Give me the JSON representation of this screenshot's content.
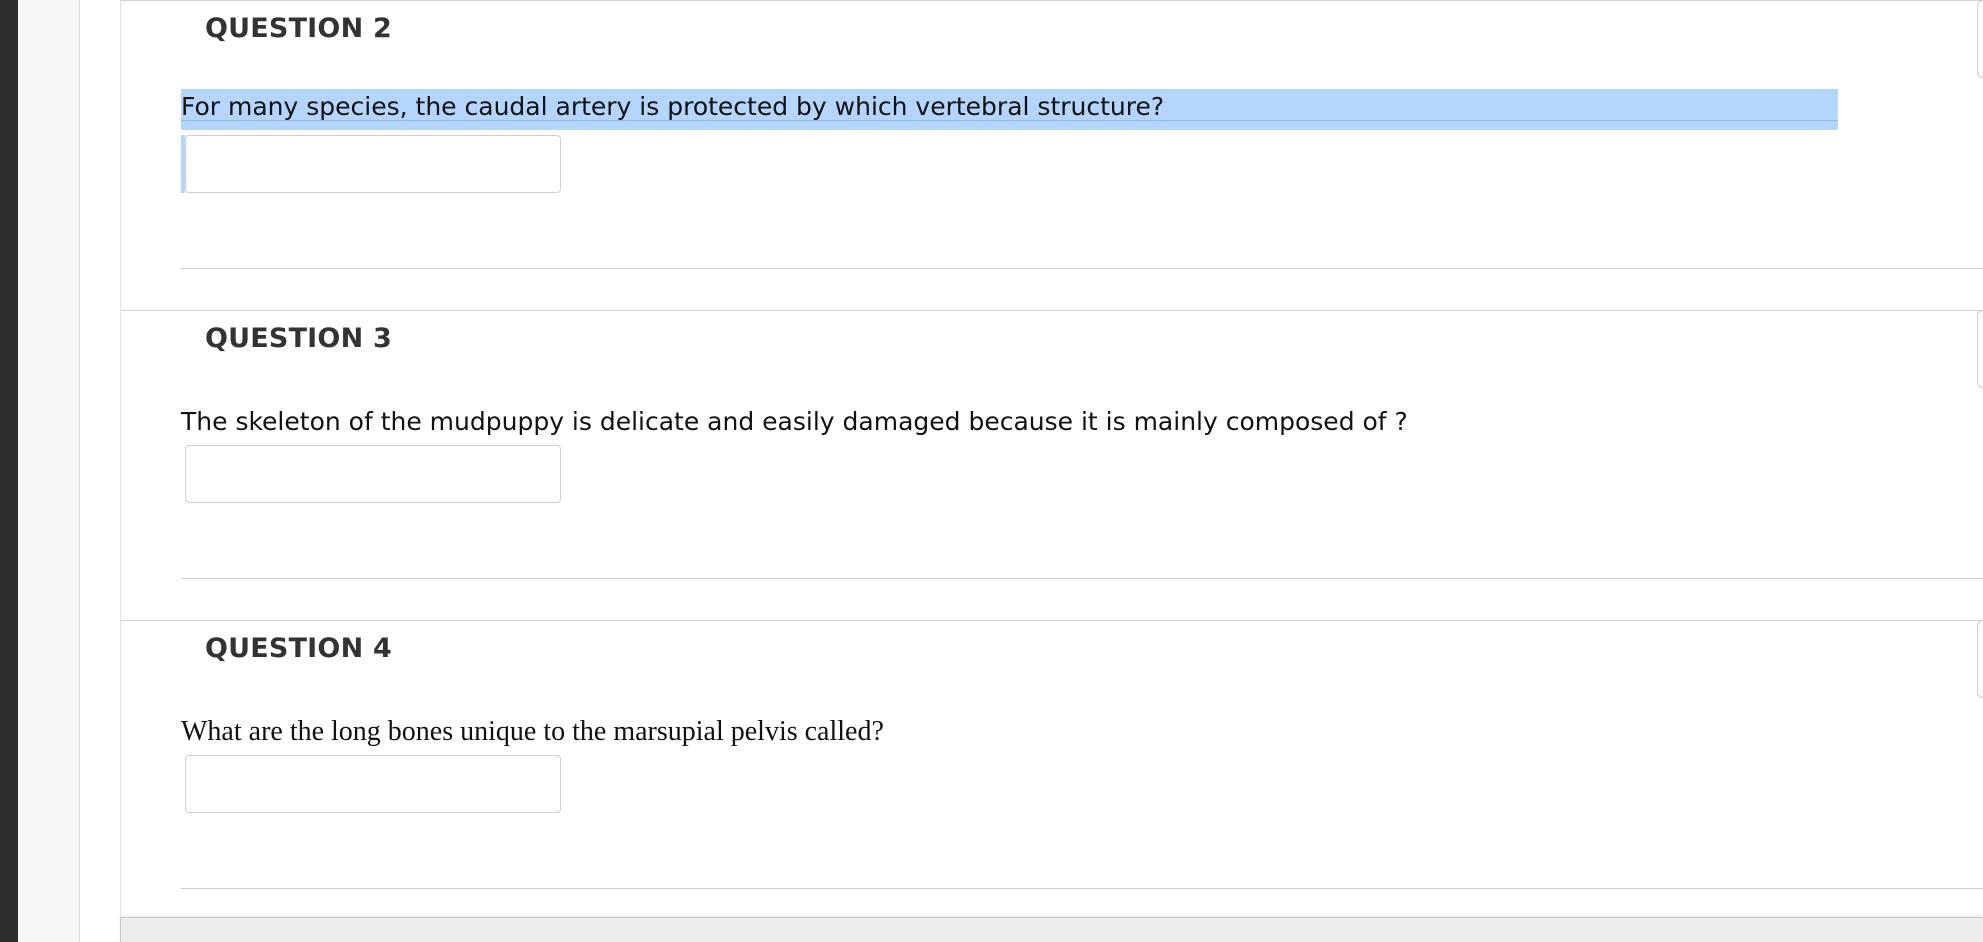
{
  "questions": [
    {
      "heading": "QUESTION 2",
      "text": "For many species, the caudal artery is protected by which vertebral structure?",
      "answer": "",
      "highlighted": true
    },
    {
      "heading": "QUESTION 3",
      "text": "The skeleton of the mudpuppy is delicate and easily damaged because it is mainly composed of ?",
      "answer": "",
      "highlighted": false
    },
    {
      "heading": "QUESTION 4",
      "text": "What are the long bones unique to the marsupial pelvis called?",
      "answer": "",
      "highlighted": false
    }
  ],
  "colors": {
    "selection_highlight": "#b4d5fd",
    "heading_text": "#333333",
    "left_bar": "#2e2e2e"
  }
}
